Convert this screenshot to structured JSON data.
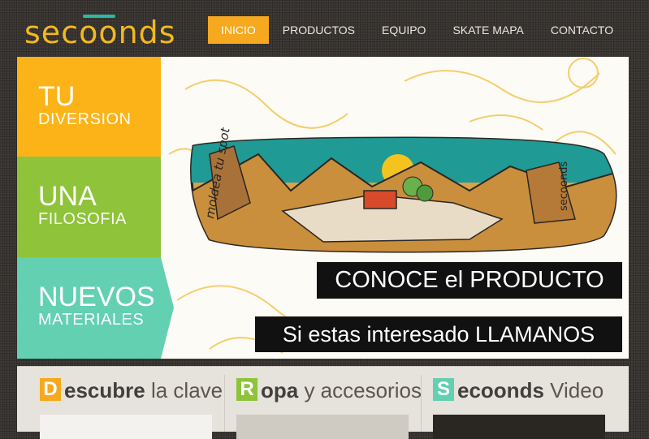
{
  "logo": {
    "text": "secoonds"
  },
  "nav": {
    "items": [
      {
        "label": "INICIO",
        "active": true
      },
      {
        "label": "PRODUCTOS"
      },
      {
        "label": "EQUIPO"
      },
      {
        "label": "SKATE MAPA"
      },
      {
        "label": "CONTACTO"
      }
    ]
  },
  "slider": {
    "tabs": [
      {
        "title": "TU",
        "subtitle": "DIVERSION",
        "color": "#fbb318"
      },
      {
        "title": "UNA",
        "subtitle": "FILOSOFIA",
        "color": "#8fc33a"
      },
      {
        "title": "NUEVOS",
        "subtitle": "MATERIALES",
        "color": "#62d0b1"
      }
    ],
    "board": {
      "deck_text": "secoonds",
      "graffiti": "moldea tu spot"
    },
    "cta_primary": "CONOCE el PRODUCTO",
    "cta_secondary": "Si estas interesado LLAMANOS"
  },
  "sections": [
    {
      "letter": "D",
      "rest": "escubre",
      "light": " la clave",
      "color": "#f6a81f"
    },
    {
      "letter": "R",
      "rest": "opa",
      "light": " y accesorios",
      "color": "#8fc33a"
    },
    {
      "letter": "S",
      "rest": "ecoonds",
      "light": " Video",
      "color": "#62d0b1"
    }
  ]
}
